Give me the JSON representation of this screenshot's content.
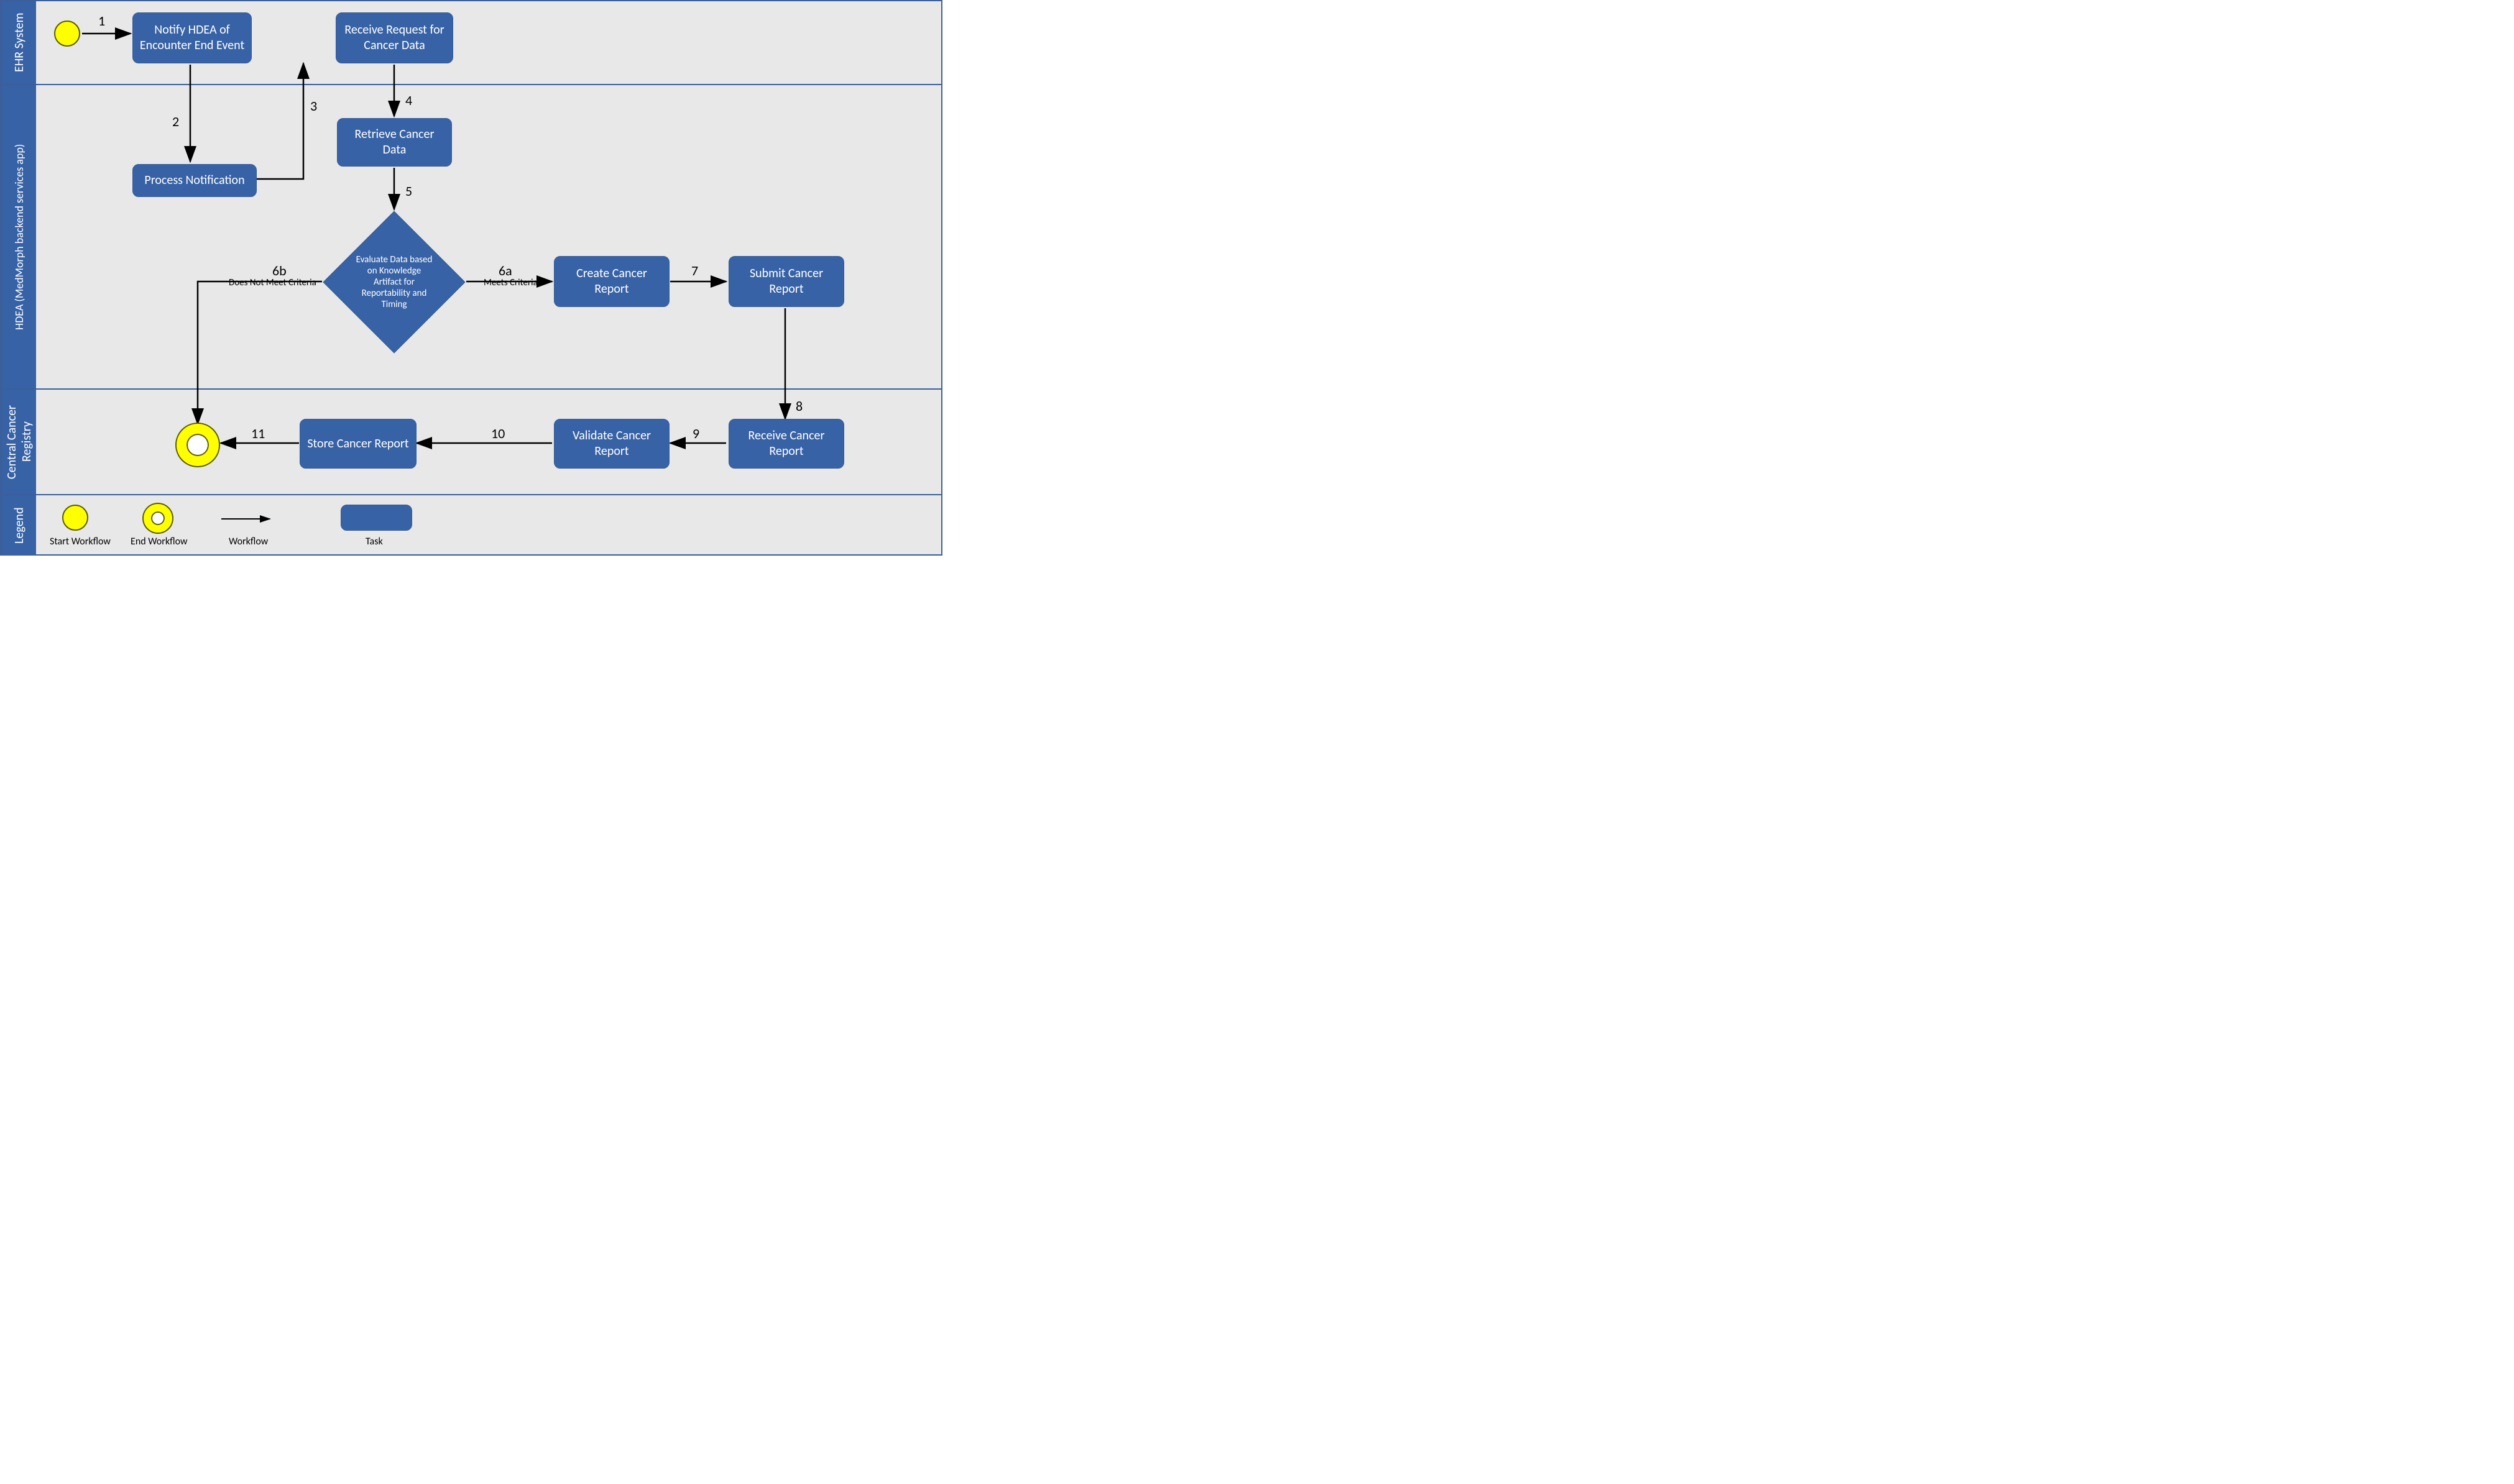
{
  "lanes": {
    "ehr": "EHR System",
    "hdea": "HDEA (MedMorph backend services app)",
    "registry": "Central Cancer Registry",
    "legend": "Legend"
  },
  "tasks": {
    "notify": "Notify HDEA of Encounter End Event",
    "receive_request": "Receive Request for Cancer Data",
    "process_notification": "Process Notification",
    "retrieve": "Retrieve Cancer Data",
    "evaluate": "Evaluate Data based on Knowledge Artifact for Reportability and Timing",
    "create_report": "Create Cancer Report",
    "submit_report": "Submit Cancer Report",
    "receive_report": "Receive Cancer Report",
    "validate_report": "Validate Cancer Report",
    "store_report": "Store Cancer Report"
  },
  "steps": {
    "s1": "1",
    "s2": "2",
    "s3": "3",
    "s4": "4",
    "s5": "5",
    "s6a": "6a",
    "s6a_label": "Meets Criteria",
    "s6b": "6b",
    "s6b_label": "Does Not Meet Criteria",
    "s7": "7",
    "s8": "8",
    "s9": "9",
    "s10": "10",
    "s11": "11"
  },
  "legend": {
    "start": "Start Workflow",
    "end": "End Workflow",
    "workflow": "Workflow",
    "task": "Task"
  }
}
